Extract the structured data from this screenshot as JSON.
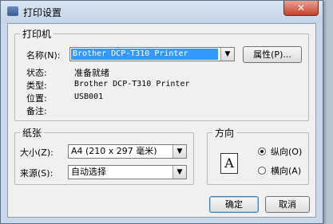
{
  "dialog": {
    "title": "打印设置",
    "close_glyph": "✕"
  },
  "printer": {
    "group_label": "打印机",
    "name_label": "名称(N):",
    "name_value": "Brother DCP-T310 Printer",
    "properties_button": "属性(P)...",
    "status_label": "状态:",
    "status_value": "准备就绪",
    "type_label": "类型:",
    "type_value": "Brother DCP-T310 Printer",
    "location_label": "位置:",
    "location_value": "USB001",
    "comment_label": "备注:",
    "comment_value": ""
  },
  "paper": {
    "group_label": "纸张",
    "size_label": "大小(Z):",
    "size_value": "A4 (210 x 297 毫米)",
    "source_label": "来源(S):",
    "source_value": "自动选择"
  },
  "orientation": {
    "group_label": "方向",
    "page_glyph": "A",
    "portrait_label": "纵向(O)",
    "landscape_label": "横向(A)",
    "selected": "portrait"
  },
  "buttons": {
    "ok": "确定",
    "cancel": "取消"
  },
  "icons": {
    "title": "printer-icon",
    "dropdown": "chevron-down-icon"
  }
}
